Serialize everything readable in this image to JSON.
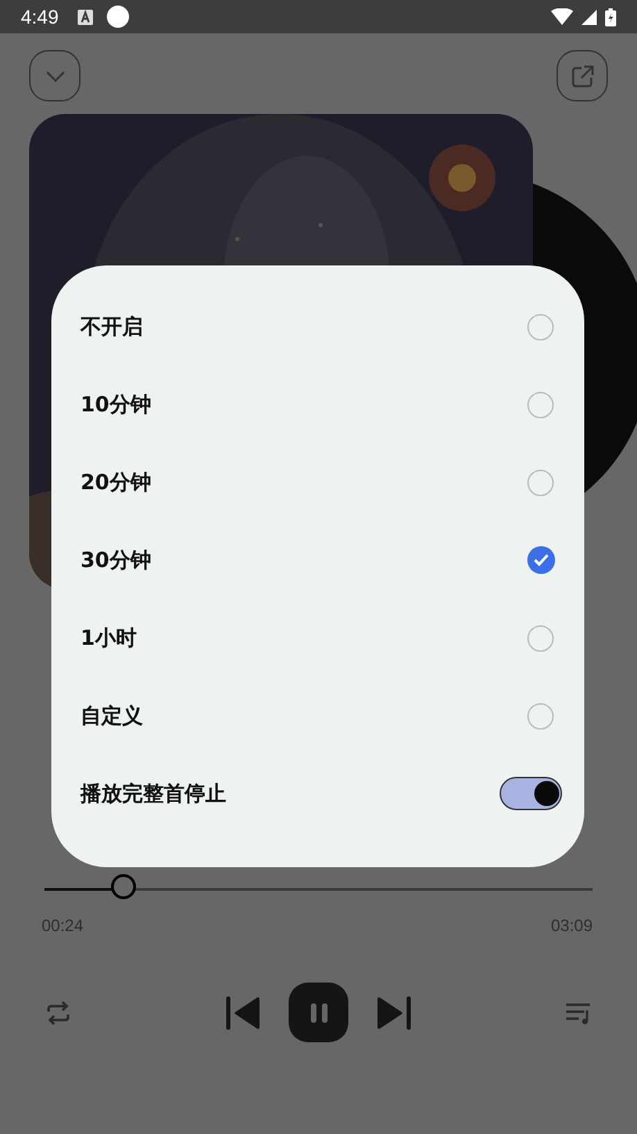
{
  "status_bar": {
    "time": "4:49"
  },
  "player": {
    "progress": {
      "level": 0.15,
      "elapsed": "00:24",
      "total": "03:09"
    }
  },
  "timer_dialog": {
    "options": [
      {
        "label": "不开启",
        "selected": false
      },
      {
        "label": "10分钟",
        "selected": false
      },
      {
        "label": "20分钟",
        "selected": false
      },
      {
        "label": "30分钟",
        "selected": true
      },
      {
        "label": "1小时",
        "selected": false
      },
      {
        "label": "自定义",
        "selected": false
      }
    ],
    "toggle": {
      "label": "播放完整首停止",
      "on": true
    }
  }
}
